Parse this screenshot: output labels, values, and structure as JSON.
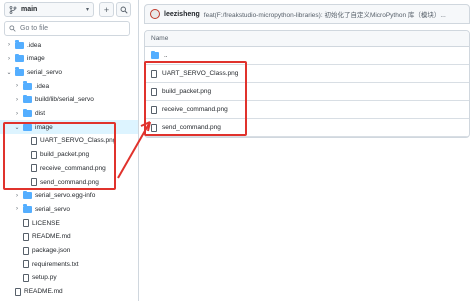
{
  "sidebar": {
    "branch": "main",
    "add_icon": "plus-icon",
    "search_icon": "search-icon",
    "goto_placeholder": "Go to file",
    "tree": [
      {
        "label": ".idea",
        "type": "folder",
        "depth": 0,
        "expanded": false
      },
      {
        "label": "image",
        "type": "folder",
        "depth": 0,
        "expanded": false
      },
      {
        "label": "serial_servo",
        "type": "folder",
        "depth": 0,
        "expanded": true
      },
      {
        "label": ".idea",
        "type": "folder",
        "depth": 1,
        "expanded": false
      },
      {
        "label": "build/lib/serial_servo",
        "type": "folder",
        "depth": 1,
        "expanded": false
      },
      {
        "label": "dist",
        "type": "folder",
        "depth": 1,
        "expanded": false
      },
      {
        "label": "image",
        "type": "folder",
        "depth": 1,
        "expanded": true,
        "selected": true
      },
      {
        "label": "UART_SERVO_Class.png",
        "type": "file",
        "depth": 2
      },
      {
        "label": "build_packet.png",
        "type": "file",
        "depth": 2
      },
      {
        "label": "receive_command.png",
        "type": "file",
        "depth": 2
      },
      {
        "label": "send_command.png",
        "type": "file",
        "depth": 2
      },
      {
        "label": "serial_servo.egg-info",
        "type": "folder",
        "depth": 1,
        "expanded": false
      },
      {
        "label": "serial_servo",
        "type": "folder",
        "depth": 1,
        "expanded": false
      },
      {
        "label": "LICENSE",
        "type": "file",
        "depth": 1
      },
      {
        "label": "README.md",
        "type": "file",
        "depth": 1
      },
      {
        "label": "package.json",
        "type": "file",
        "depth": 1
      },
      {
        "label": "requirements.txt",
        "type": "file",
        "depth": 1
      },
      {
        "label": "setup.py",
        "type": "file",
        "depth": 1
      },
      {
        "label": "README.md",
        "type": "file",
        "depth": 0
      }
    ]
  },
  "commit": {
    "author": "leezisheng",
    "message": "feat(F:/freakstudio-micropython-libraries): 初始化了自定义MicroPython 库（模块）..."
  },
  "files": {
    "header": "Name",
    "parent": "..",
    "rows": [
      "UART_SERVO_Class.png",
      "build_packet.png",
      "receive_command.png",
      "send_command.png"
    ]
  },
  "colors": {
    "accent": "#0969da",
    "highlight": "#e0322c",
    "folder": "#54aeff"
  }
}
